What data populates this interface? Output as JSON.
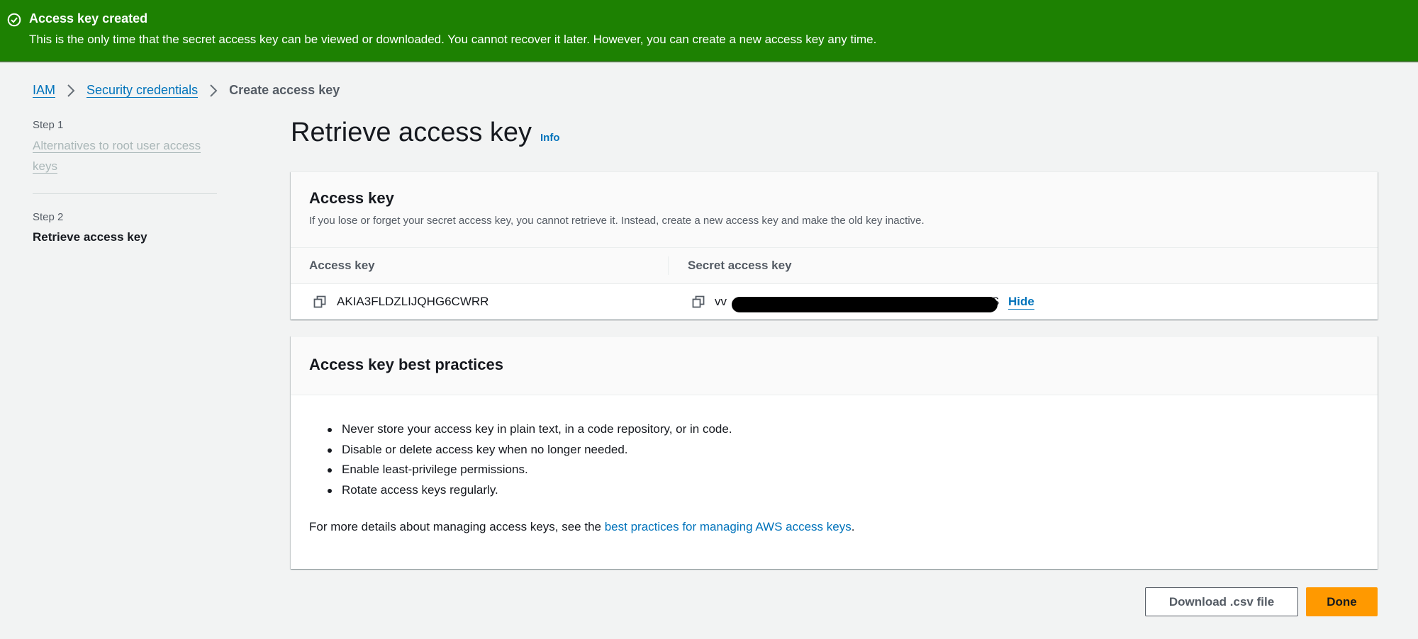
{
  "flash": {
    "icon": "check-circle-icon",
    "title": "Access key created",
    "message": "This is the only time that the secret access key can be viewed or downloaded. You cannot recover it later. However, you can create a new access key any time.",
    "color": "#1d8102"
  },
  "breadcrumb": {
    "items": [
      "IAM",
      "Security credentials"
    ],
    "current": "Create access key",
    "separator_icon": "chevron-right-icon"
  },
  "steps": [
    {
      "label": "Step 1",
      "title": "Alternatives to root user access keys",
      "state": "completed"
    },
    {
      "label": "Step 2",
      "title": "Retrieve access key",
      "state": "current"
    }
  ],
  "page": {
    "title": "Retrieve access key",
    "info_link": "Info"
  },
  "access_key_panel": {
    "heading": "Access key",
    "description": "If you lose or forget your secret access key, you cannot retrieve it. Instead, create a new access key and make the old key inactive.",
    "columns": [
      "Access key",
      "Secret access key"
    ],
    "access_key_value": "AKIA3FLDZLIJQHG6CWRR",
    "secret_prefix": "vv",
    "secret_suffix": "S",
    "secret_redacted": true,
    "hide_label": "Hide",
    "copy_icon": "copy-icon"
  },
  "best_practices_panel": {
    "heading": "Access key best practices",
    "items": [
      "Never store your access key in plain text, in a code repository, or in code.",
      "Disable or delete access key when no longer needed.",
      "Enable least-privilege permissions.",
      "Rotate access keys regularly."
    ],
    "more_prefix": "For more details about managing access keys, see the ",
    "more_link": "best practices for managing AWS access keys",
    "more_suffix": "."
  },
  "actions": {
    "download_label": "Download .csv file",
    "done_label": "Done",
    "primary_color": "#ff9900"
  },
  "colors": {
    "link": "#0073bb",
    "background": "#f2f3f3"
  }
}
